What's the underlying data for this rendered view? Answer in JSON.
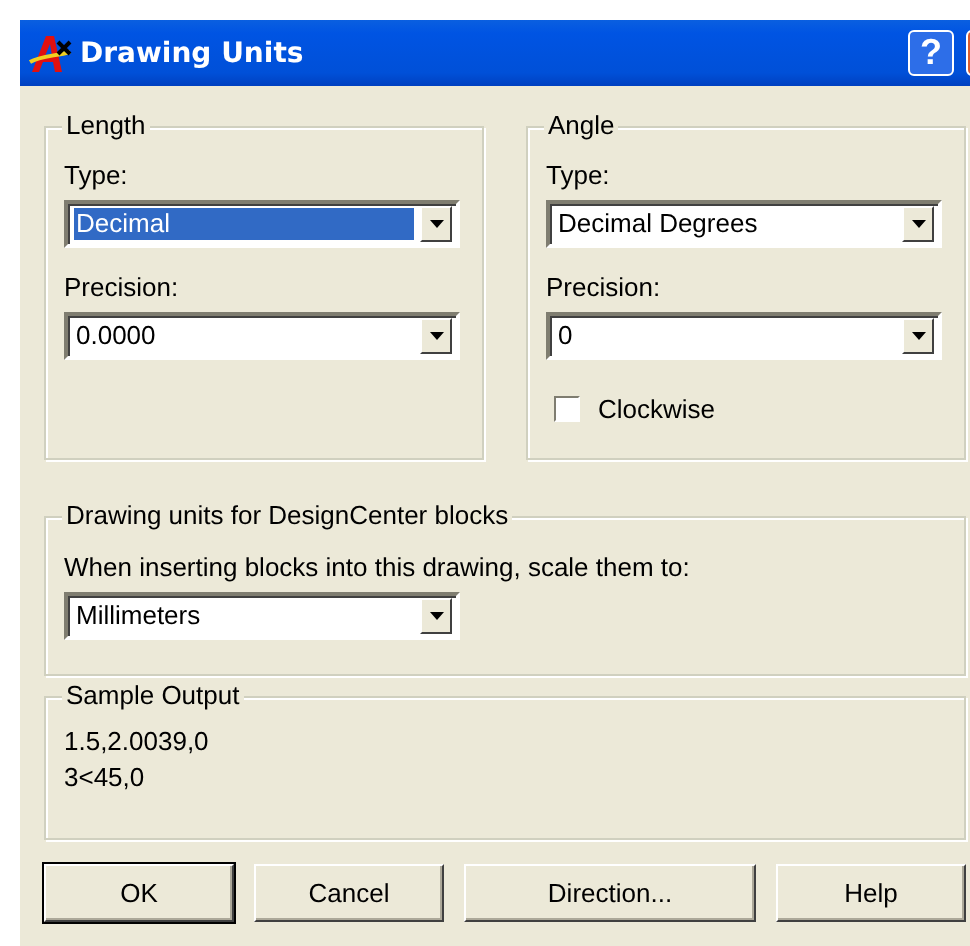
{
  "window": {
    "title": "Drawing Units",
    "controls": [
      {
        "kind": "help",
        "label": "?"
      },
      {
        "kind": "close"
      }
    ]
  },
  "length": {
    "title": "Length",
    "type_label": "Type:",
    "type": {
      "value": "Decimal",
      "focused": true
    },
    "precision_label": "Precision:",
    "precision": {
      "value": "0.0000",
      "focused": false
    }
  },
  "angle": {
    "title": "Angle",
    "type_label": "Type:",
    "type": {
      "value": "Decimal Degrees",
      "focused": false
    },
    "precision_label": "Precision:",
    "precision": {
      "value": "0",
      "focused": false
    },
    "clockwise": {
      "label": "Clockwise",
      "checked": false
    }
  },
  "design_center": {
    "title": "Drawing units for DesignCenter blocks",
    "prompt": "When inserting blocks into this drawing, scale them to:",
    "units": {
      "value": "Millimeters",
      "focused": false
    }
  },
  "sample_output": {
    "title": "Sample Output",
    "lines": [
      "1.5,2.0039,0",
      "3<45,0"
    ]
  },
  "buttons": [
    {
      "label": "OK",
      "default": true
    },
    {
      "label": "Cancel",
      "default": false
    },
    {
      "label": "Direction...",
      "default": false
    },
    {
      "label": "Help",
      "default": false
    }
  ]
}
